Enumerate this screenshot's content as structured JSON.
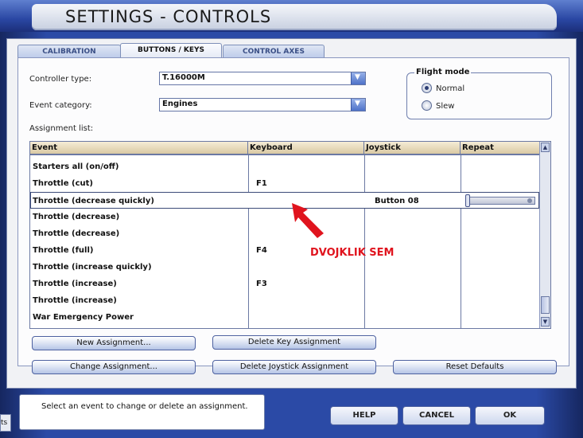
{
  "window": {
    "title": "SETTINGS - CONTROLS"
  },
  "tabs": [
    {
      "label": "CALIBRATION"
    },
    {
      "label": "BUTTONS / KEYS"
    },
    {
      "label": "CONTROL AXES"
    }
  ],
  "form": {
    "controller_type_label": "Controller type:",
    "controller_type_value": "T.16000M",
    "event_category_label": "Event category:",
    "event_category_value": "Engines",
    "assignment_list_label": "Assignment list:"
  },
  "flight_mode": {
    "title": "Flight mode",
    "options": [
      {
        "label": "Normal",
        "selected": true
      },
      {
        "label": "Slew",
        "selected": false
      }
    ]
  },
  "table": {
    "headers": [
      "Event",
      "Keyboard",
      "Joystick",
      "Repeat"
    ],
    "rows": [
      {
        "event": "Starters all (on/off)",
        "keyboard": "",
        "joystick": ""
      },
      {
        "event": "Throttle (cut)",
        "keyboard": "F1",
        "joystick": ""
      },
      {
        "event": "Throttle (decrease quickly)",
        "keyboard": "",
        "joystick": "Button 08"
      },
      {
        "event": "Throttle (decrease)",
        "keyboard": "",
        "joystick": ""
      },
      {
        "event": "Throttle (decrease)",
        "keyboard": "",
        "joystick": ""
      },
      {
        "event": "Throttle (full)",
        "keyboard": "F4",
        "joystick": ""
      },
      {
        "event": "Throttle (increase quickly)",
        "keyboard": "",
        "joystick": ""
      },
      {
        "event": "Throttle (increase)",
        "keyboard": "F3",
        "joystick": ""
      },
      {
        "event": "Throttle (increase)",
        "keyboard": "",
        "joystick": ""
      },
      {
        "event": "War Emergency Power",
        "keyboard": "",
        "joystick": ""
      }
    ],
    "selected_row": 2
  },
  "annotation": {
    "text": "DVOJKLIK SEM",
    "color": "#e0141e"
  },
  "buttons": {
    "new_assignment": "New Assignment...",
    "delete_key_assignment": "Delete Key Assignment",
    "change_assignment": "Change Assignment...",
    "delete_joystick_assignment": "Delete Joystick Assignment",
    "reset_defaults": "Reset Defaults",
    "help": "HELP",
    "cancel": "CANCEL",
    "ok": "OK"
  },
  "status": {
    "text": "Select an event to change or delete an assignment.",
    "left_stub": "ts"
  }
}
